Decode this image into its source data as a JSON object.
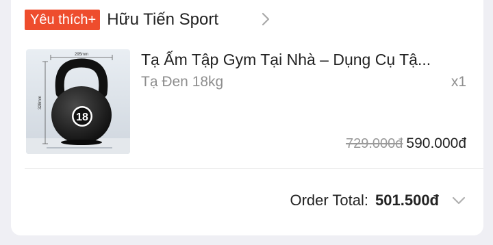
{
  "shop": {
    "badge_label": "Yêu thích+",
    "name": "Hữu Tiến Sport",
    "chevron_icon": "chevron-right-icon",
    "badge_color": "#ee4d2d"
  },
  "product": {
    "title": "Tạ Ấm Tập Gym Tại Nhà – Dụng Cụ Tậ...",
    "variant": "Tạ Đen 18kg",
    "quantity": "x1",
    "original_price": "729.000đ",
    "price": "590.000đ",
    "image": {
      "width_label": "295mm",
      "height_label": "328mm",
      "weight_number": "18"
    }
  },
  "order": {
    "total_label": "Order Total:",
    "total_value": "501.500đ",
    "expand_icon": "chevron-down-icon"
  }
}
